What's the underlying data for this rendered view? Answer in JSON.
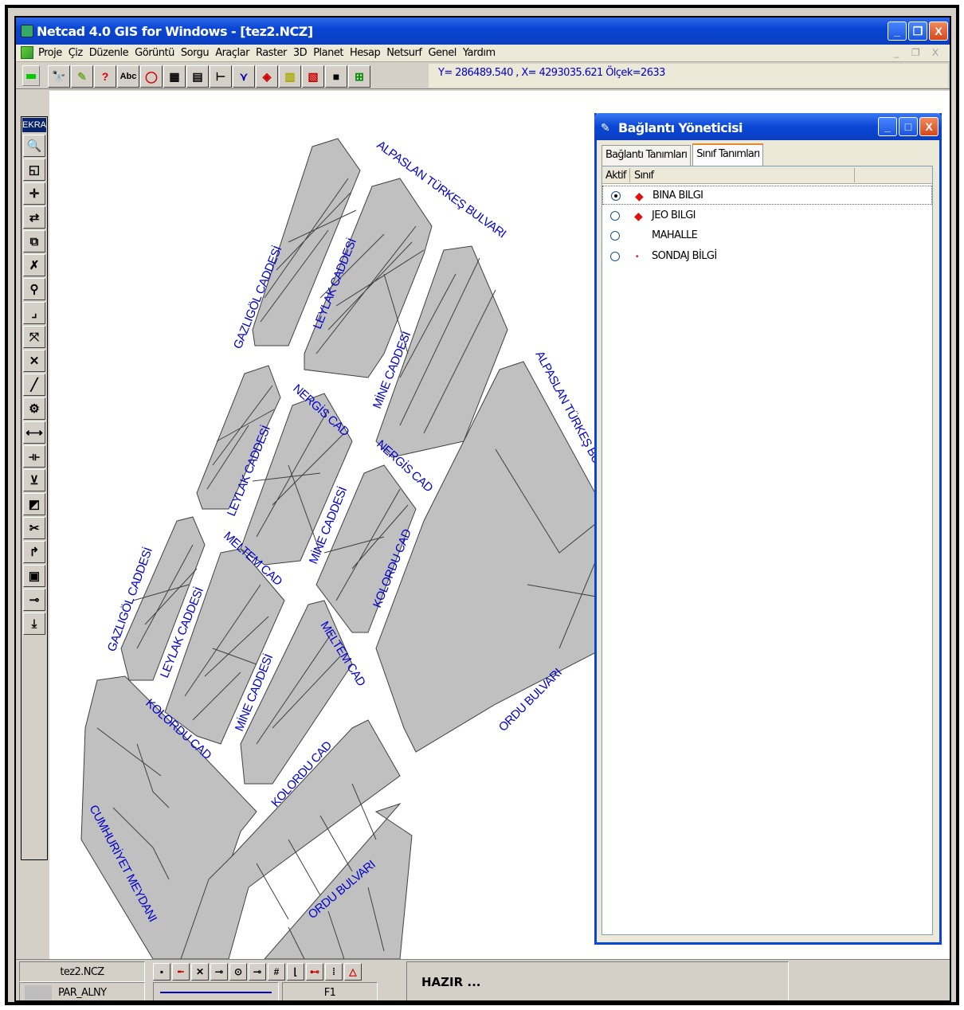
{
  "window": {
    "title": "Netcad 4.0 GIS for Windows - [tez2.NCZ]",
    "minimize": "_",
    "maximize": "❐",
    "close": "X"
  },
  "menu": [
    "Proje",
    "Çiz",
    "Düzenle",
    "Görüntü",
    "Sorgu",
    "Araçlar",
    "Raster",
    "3D",
    "Planet",
    "Hesap",
    "Netsurf",
    "Genel",
    "Yardım"
  ],
  "mdi_controls": "_ ❐ X",
  "toolbar": {
    "coordinates": "Y= 286489.540 , X= 4293035.621 Ölçek=2633",
    "buttons": [
      "🔭",
      "✎",
      "?",
      "Abc",
      "◯",
      "▦",
      "▤",
      "⊢",
      "⋎",
      "◈",
      "▥",
      "▧",
      "■",
      "⊞"
    ]
  },
  "vtoolbar": {
    "label": "EKRA",
    "buttons": [
      "🔍",
      "◱",
      "✛",
      "⇄",
      "⧉",
      "✗",
      "⚲",
      "⌟",
      "⤧",
      "✕",
      "╱",
      "⚙",
      "⟷",
      "⟛",
      "⊻",
      "◩",
      "✂",
      "↱",
      "▣",
      "⊸",
      "⤓"
    ]
  },
  "map": {
    "streets": [
      "ALPASLAN TÜRKEŞ BULVARI",
      "GAZLIGÖL CADDESİ",
      "LEYLAK CADDESİ",
      "MİNE CADDESİ",
      "NERGİS CAD",
      "NERGİS CAD",
      "ALPASLAN TÜRKEŞ BUL",
      "LEYLAK CADDESİ",
      "MİNE CADDESİ",
      "MELTEM CAD",
      "KOLORDU CAD",
      "GAZLIGÖL CADDESİ",
      "LEYLAK CADDESİ",
      "MİNE CADDESİ",
      "MELTEM CAD",
      "ORDU BULVARI",
      "KOLORDU CAD",
      "KOLORDU CAD",
      "CUMHURİYET MEYDANI",
      "ORDU BULVARI"
    ]
  },
  "dialog": {
    "title": "Bağlantı Yöneticisi",
    "tabs": [
      "Bağlantı Tanımları",
      "Sınıf Tanımları"
    ],
    "columns": [
      "Aktif",
      "Sınıf"
    ],
    "rows": [
      {
        "label": "BINA BILGI",
        "marker": "◆"
      },
      {
        "label": "JEO BILGI",
        "marker": "◆"
      },
      {
        "label": "MAHALLE",
        "marker": ""
      },
      {
        "label": "SONDAJ BİLGİ",
        "marker": "•"
      }
    ]
  },
  "status": {
    "file": "tez2.NCZ",
    "layer": "PAR_ALNY",
    "key": "F1",
    "message": "HAZIR ...",
    "tools": [
      "▪",
      "╾",
      "✕",
      "⊸",
      "⊙",
      "⊸",
      "#",
      "⌊",
      "⊷",
      "⁞",
      "△"
    ]
  },
  "colors": {
    "title_bar": "#0a46d4",
    "parcel_fill": "#c0c0c0",
    "street_label": "#0000cc",
    "marker": "#e01010"
  }
}
